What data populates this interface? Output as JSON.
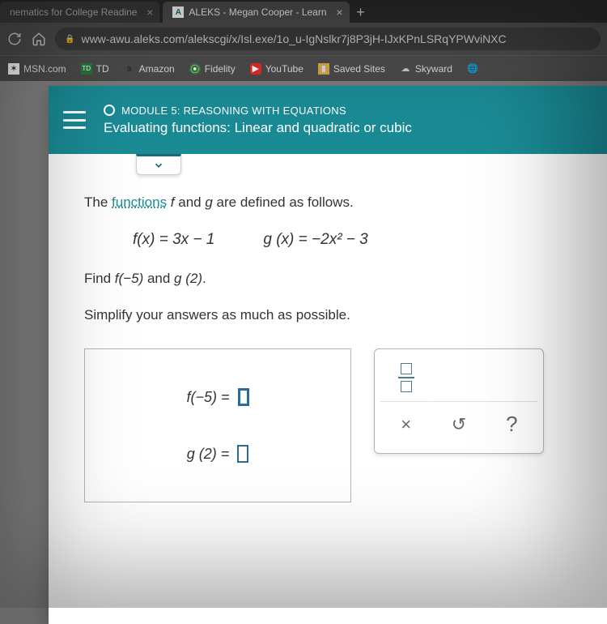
{
  "tabs": {
    "inactive": "nematics for College Readine",
    "active": "ALEKS - Megan Cooper - Learn"
  },
  "url": "www-awu.aleks.com/alekscgi/x/Isl.exe/1o_u-IgNslkr7j8P3jH-IJxKPnLSRqYPWviNXC",
  "bookmarks": {
    "msn": "MSN.com",
    "td": "TD",
    "amazon": "Amazon",
    "fidelity": "Fidelity",
    "youtube": "YouTube",
    "saved": "Saved Sites",
    "skyward": "Skyward"
  },
  "header": {
    "module": "MODULE 5: REASONING WITH EQUATIONS",
    "topic": "Evaluating functions: Linear and quadratic or cubic"
  },
  "problem": {
    "intro_pre": "The ",
    "functions_link": "functions",
    "intro_post": " f and g are defined as follows.",
    "f_def": "f(x) = 3x − 1",
    "g_def": "g (x) = −2x² − 3",
    "find": "Find f(−5) and g (2).",
    "simplify": "Simplify your answers as much as possible.",
    "ans_f": "f(−5) = ",
    "ans_g": "g (2) = "
  },
  "tools": {
    "times": "×",
    "undo": "↺",
    "help": "?"
  }
}
